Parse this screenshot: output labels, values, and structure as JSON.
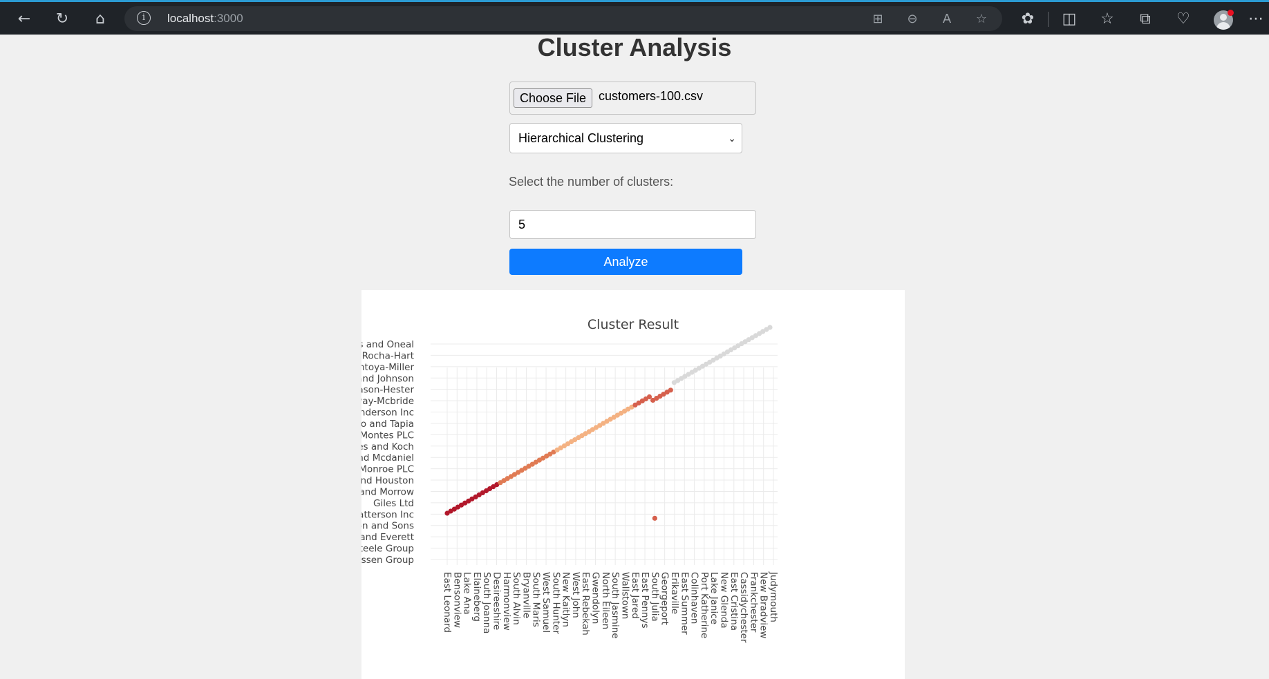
{
  "browser": {
    "url_host": "localhost",
    "url_port": ":3000",
    "icons": [
      "back-icon",
      "refresh-icon",
      "home-icon",
      "info-icon",
      "apps-icon",
      "zoom-out-icon",
      "read-aloud-icon",
      "favorite-star-icon",
      "extensions-icon",
      "split-screen-icon",
      "favorites-icon",
      "collections-icon",
      "browser-essentials-icon",
      "profile-icon",
      "more-icon"
    ]
  },
  "page": {
    "title": "Cluster Analysis",
    "file_button_label": "Choose File",
    "file_name": "customers-100.csv",
    "method_selected": "Hierarchical Clustering",
    "clusters_label": "Select the number of clusters:",
    "clusters_value": "5",
    "analyze_label": "Analyze"
  },
  "colors": {
    "cluster_0": "#b2182b",
    "cluster_1": "#e07b54",
    "cluster_2": "#f4b283",
    "cluster_3": "#d6604d",
    "cluster_4": "#d9d9d9",
    "analyze_button": "#0d7bff"
  },
  "chart_data": {
    "type": "scatter",
    "title": "Cluster Result",
    "xlabel": "",
    "ylabel": "",
    "grid": true,
    "x_tick_labels": [
      "East Leonard",
      "Bensonview",
      "Lake Ana",
      "Elaineberg",
      "South Joanna",
      "Desireeshire",
      "Harmonview",
      "South Alvin",
      "Bryanville",
      "South Maris",
      "West Samuel",
      "South Hunter",
      "New Kaitlyn",
      "West John",
      "East Rebekah",
      "Gwendolyn",
      "North Eileen",
      "South Jasmine",
      "Wallstown",
      "East Jared",
      "East Pennys",
      "South Julia",
      "Georgeport",
      "Erikaville",
      "East Summer",
      "Colinhaven",
      "Port Katherine",
      "Lake Janice",
      "New Glenda",
      "East Cristina",
      "Cassidychester",
      "Frankchester",
      "New Bradview",
      "Judymouth"
    ],
    "y_tick_labels": [
      "Rasmussen Group",
      "Steele Group",
      "Wilkinson and Everett",
      "Houston and Sons",
      "Patterson Inc",
      "Giles Ltd",
      "Brown and Morrow",
      "Russell and Houston",
      "Monroe PLC",
      "Bray and Mcdaniel",
      "Hughes and Koch",
      "Montes PLC",
      "Camacho and Tapia",
      "Henderson Inc",
      "Conway-Mcbride",
      "Mason-Hester",
      "Neal and Johnson",
      "Montoya-Miller",
      "Rocha-Hart",
      "Hodges and Oneal"
    ],
    "series": [
      {
        "count": 15
      },
      {
        "count": 16
      },
      {
        "count": 22
      },
      {
        "count": 11
      },
      {
        "count": 28
      },
      {
        "count": 1
      }
    ],
    "outlier": {
      "x_tick": "South Julia",
      "y_tick": "Patterson Inc"
    }
  }
}
